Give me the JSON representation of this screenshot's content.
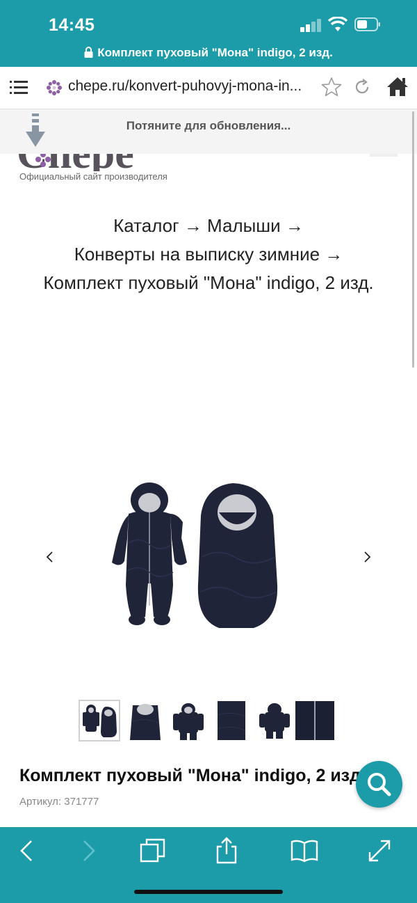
{
  "status_bar": {
    "time": "14:45"
  },
  "header": {
    "page_title": "Комплект пуховый \"Мона\" indigo, 2 изд."
  },
  "browser": {
    "url": "chepe.ru/konvert-puhovyj-mona-in..."
  },
  "pull_to_refresh": {
    "text": "Потяните для обновления..."
  },
  "site": {
    "logo_text": "Chepe",
    "logo_subtitle": "Официальный сайт производителя"
  },
  "breadcrumb": {
    "line1": "Каталог → Малыши →",
    "line2": "Конверты на выписку зимние →",
    "line3": "Комплект пуховый \"Мона\" indigo, 2 изд."
  },
  "product": {
    "name": "Комплект пуховый \"Мона\" indigo, 2 изд.",
    "sku": "Артикул: 371777",
    "thumbnail_count": 6
  },
  "icons": {
    "menu": "menu-icon",
    "site": "site-favicon-icon",
    "bookmark": "star-icon",
    "reload": "reload-icon",
    "home": "home-icon",
    "search": "search-icon",
    "back": "back-icon",
    "forward": "forward-icon",
    "tabs": "tabs-icon",
    "share": "share-icon",
    "bookmarks": "book-icon",
    "fullscreen": "expand-icon"
  },
  "colors": {
    "accent": "#1c9ba8",
    "product": "#1f2438"
  }
}
